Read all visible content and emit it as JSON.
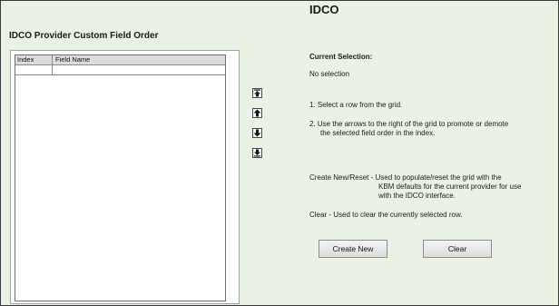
{
  "header": {
    "title": "IDCO"
  },
  "section": {
    "title": "IDCO Provider Custom Field Order"
  },
  "grid": {
    "columns": [
      "Index",
      "Field Name"
    ],
    "rows": [
      {
        "index": "",
        "field_name": ""
      }
    ]
  },
  "arrows": [
    {
      "icon": "move-to-top-icon"
    },
    {
      "icon": "move-up-icon"
    },
    {
      "icon": "move-down-icon"
    },
    {
      "icon": "move-to-bottom-icon"
    }
  ],
  "current_selection": {
    "label": "Current Selection:",
    "value": "No selection"
  },
  "instructions": {
    "step1": "1. Select a row from the grid.",
    "step2_line1": "2. Use the arrows to the right of the grid to promote or demote",
    "step2_line2": "the selected field order in the index."
  },
  "help": {
    "create_line1": "Create New/Reset - Used to populate/reset the grid with the",
    "create_line2": "KBM defaults for the current provider for use",
    "create_line3": "with the IDCO interface.",
    "clear": "Clear - Used to clear the currently selected row."
  },
  "buttons": {
    "create_new": "Create New",
    "clear": "Clear"
  },
  "colors": {
    "background": "#eaf2e3",
    "grid_header": "#dcdcdc"
  }
}
